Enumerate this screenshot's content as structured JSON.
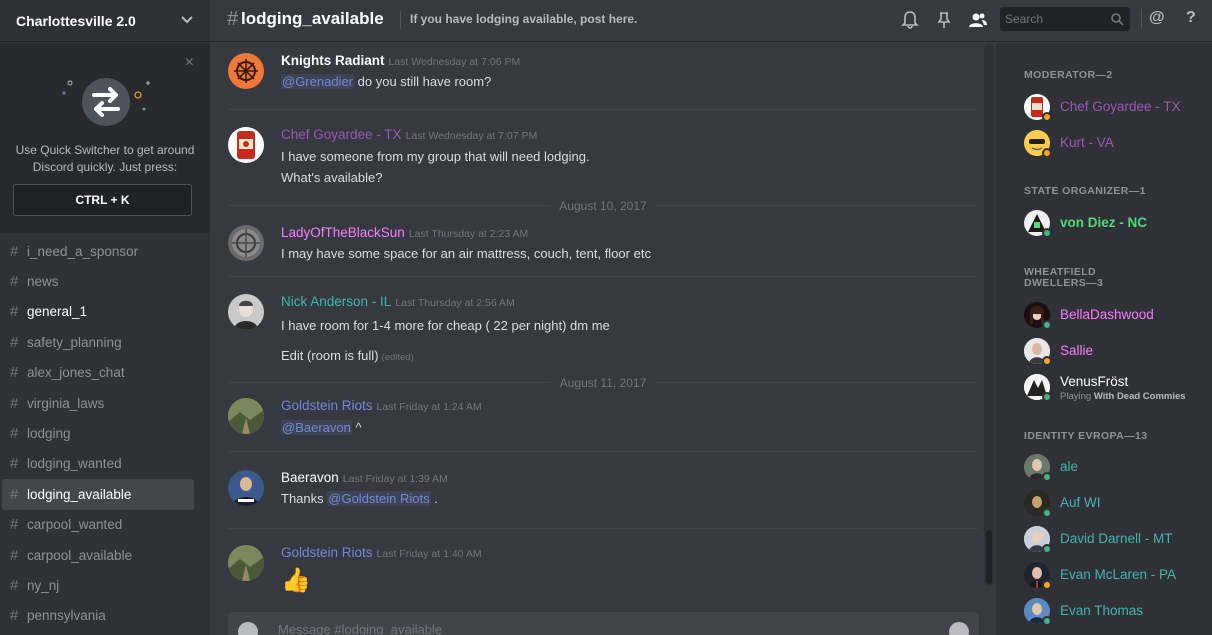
{
  "server": {
    "name": "Charlottesville 2.0"
  },
  "quick_switcher": {
    "text": "Use Quick Switcher to get around Discord quickly. Just press:",
    "shortcut": "CTRL + K",
    "close": "×"
  },
  "channels": [
    {
      "name": "i_need_a_sponsor",
      "state": "normal"
    },
    {
      "name": "news",
      "state": "normal"
    },
    {
      "name": "general_1",
      "state": "unread"
    },
    {
      "name": "safety_planning",
      "state": "normal"
    },
    {
      "name": "alex_jones_chat",
      "state": "normal"
    },
    {
      "name": "virginia_laws",
      "state": "normal"
    },
    {
      "name": "lodging",
      "state": "normal"
    },
    {
      "name": "lodging_wanted",
      "state": "normal"
    },
    {
      "name": "lodging_available",
      "state": "active"
    },
    {
      "name": "carpool_wanted",
      "state": "normal"
    },
    {
      "name": "carpool_available",
      "state": "normal"
    },
    {
      "name": "ny_nj",
      "state": "normal"
    },
    {
      "name": "pennsylvania",
      "state": "normal"
    }
  ],
  "topbar": {
    "hash": "#",
    "channel": "lodging_available",
    "topic": "If you have lodging available, post here.",
    "search_placeholder": "Search",
    "icons": [
      "bell-icon",
      "pin-icon",
      "members-icon",
      "search-icon",
      "at-icon",
      "help-icon"
    ],
    "at": "@",
    "help": "?"
  },
  "messages": [
    {
      "author": "Knights Radiant",
      "color": "#ffffff",
      "timestamp": "Last Wednesday at 7:06 PM",
      "mention": "@Grenadier",
      "text": "do you still have room?"
    },
    {
      "author": "Chef Goyardee - TX",
      "color": "#9b59b6",
      "timestamp": "Last Wednesday at 7:07 PM",
      "line1": "I have someone from my group that will need lodging.",
      "line2": "What's available?"
    },
    {
      "day": "August 10, 2017"
    },
    {
      "author": "LadyOfTheBlackSun",
      "color": "#f47fff",
      "timestamp": "Last Thursday at 2:23 AM",
      "text": "I may have some space for an air mattress, couch, tent, floor etc"
    },
    {
      "author": "Nick Anderson - IL",
      "color": "#43b5b0",
      "timestamp": "Last Thursday at 2:56 AM",
      "line1": "I have room for 1-4 more for  cheap ( 22 per night) dm me",
      "line2": "Edit (room is full)",
      "edited": "(edited)"
    },
    {
      "day": "August 11, 2017"
    },
    {
      "author": "Goldstein Riots",
      "color": "#7289da",
      "timestamp": "Last Friday at 1:24 AM",
      "mention": "@Baeravon",
      "text": "^"
    },
    {
      "author": "Baeravon",
      "color": "#ffffff",
      "timestamp": "Last Friday at 1:39 AM",
      "prefix": "Thanks",
      "mention": "@Goldstein Riots",
      "text": "."
    },
    {
      "author": "Goldstein Riots",
      "color": "#7289da",
      "timestamp": "Last Friday at 1:40 AM",
      "emoji": "👍"
    }
  ],
  "composer": {
    "placeholder": "Message #lodging_available"
  },
  "members": {
    "roles": [
      {
        "title": "MODERATOR—2",
        "members": [
          {
            "name": "Chef Goyardee - TX",
            "color": "#9b59b6",
            "status": "#faa61a"
          },
          {
            "name": "Kurt - VA",
            "color": "#9b59b6",
            "status": "#faa61a"
          }
        ]
      },
      {
        "title": "STATE ORGANIZER—1",
        "members": [
          {
            "name": "von Diez - NC",
            "color": "#4ddc7a",
            "status": "#43b581"
          }
        ]
      },
      {
        "title": "WHEATFIELD DWELLERS—3",
        "members": [
          {
            "name": "BellaDashwood",
            "color": "#f47fff",
            "status": "#43b581"
          },
          {
            "name": "Sallie",
            "color": "#f47fff",
            "status": "#faa61a"
          },
          {
            "name": "VenusFröst",
            "color": "#ffffff",
            "status": "#43b581",
            "playing_label": "Playing",
            "playing_game": "With Dead Commies"
          }
        ]
      },
      {
        "title": "IDENTITY EVROPA—13",
        "members": [
          {
            "name": "ale",
            "color": "#43b5b0",
            "status": "#43b581"
          },
          {
            "name": "Auf WI",
            "color": "#43b5b0",
            "status": "#43b581"
          },
          {
            "name": "David Darnell - MT",
            "color": "#43b5b0",
            "status": "#43b581"
          },
          {
            "name": "Evan McLaren - PA",
            "color": "#43b5b0",
            "status": "#faa61a"
          },
          {
            "name": "Evan Thomas",
            "color": "#43b5b0",
            "status": "#43b581"
          }
        ]
      }
    ]
  }
}
